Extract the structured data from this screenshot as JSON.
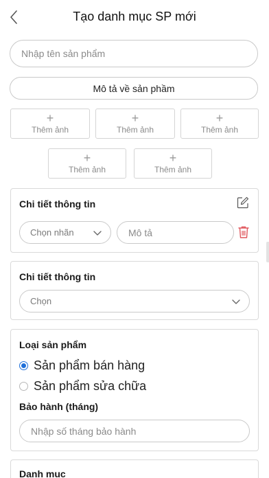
{
  "header": {
    "title": "Tạo danh mục SP mới"
  },
  "name_input": {
    "placeholder": "Nhập tên sản phẩm"
  },
  "description_button": {
    "label": "Mô tả về sản phầm"
  },
  "image_slots": {
    "plus": "+",
    "label": "Thêm ảnh"
  },
  "detail_card": {
    "title": "Chi tiết thông tin",
    "label_select": "Chọn nhãn",
    "description_placeholder": "Mô tả"
  },
  "detail_card_2": {
    "title": "Chi tiết thông tin",
    "select": "Chọn"
  },
  "product_type": {
    "title": "Loại sản phẩm",
    "options": [
      {
        "label": "Sản phẩm bán hàng",
        "selected": true
      },
      {
        "label": "Sản phẩm sửa chữa",
        "selected": false
      }
    ],
    "warranty_title": "Bảo hành (tháng)",
    "warranty_placeholder": "Nhập số tháng bảo hành"
  },
  "category": {
    "title": "Danh mục"
  },
  "colors": {
    "accent": "#1e6fd9",
    "delete": "#e0555b",
    "border": "#c9c9c9"
  }
}
